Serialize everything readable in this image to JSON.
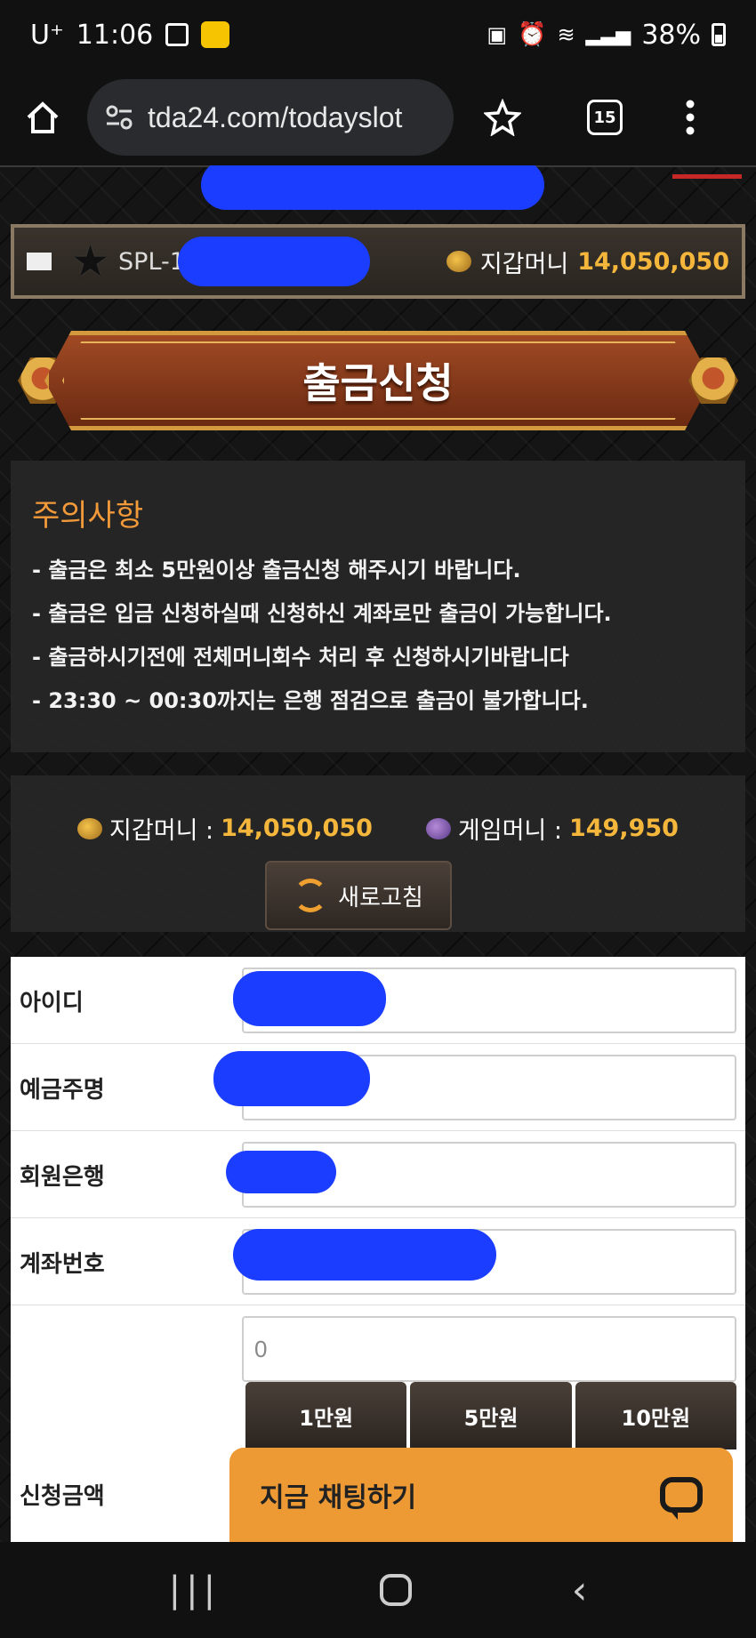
{
  "status_bar": {
    "carrier": "U⁺",
    "time": "11:06",
    "battery": "38%"
  },
  "browser": {
    "url": "tda24.com/todayslot",
    "tab_count": "15"
  },
  "user_bar": {
    "user_id": "SPL-1",
    "wallet_label": "지갑머니",
    "wallet_value": "14,050,050"
  },
  "banner": {
    "title": "출금신청"
  },
  "notice": {
    "title": "주의사항",
    "lines": [
      "- 출금은 최소 5만원이상 출금신청 해주시기 바랍니다.",
      "- 출금은 입금 신청하실때 신청하신 계좌로만 출금이 가능합니다.",
      "- 출금하시기전에 전체머니회수 처리 후 신청하시기바랍니다",
      "- 23:30 ~ 00:30까지는 은행 점검으로 출금이 불가합니다."
    ]
  },
  "money": {
    "wallet_label": "지갑머니 : ",
    "wallet_value": "14,050,050",
    "game_label": "게임머니 : ",
    "game_value": "149,950",
    "refresh_label": "새로고침"
  },
  "form": {
    "id_label": "아이디",
    "depositor_label": "예금주명",
    "bank_label": "회원은행",
    "account_label": "계좌번호",
    "amount_value": "0",
    "amount_label": "신청금액",
    "amount_buttons": [
      "1만원",
      "5만원",
      "10만원"
    ]
  },
  "chat": {
    "label": "지금 채팅하기"
  },
  "colors": {
    "accent_gold": "#f4b73c",
    "notice_title": "#f29a3a",
    "chat_bg": "#ed9a35"
  }
}
